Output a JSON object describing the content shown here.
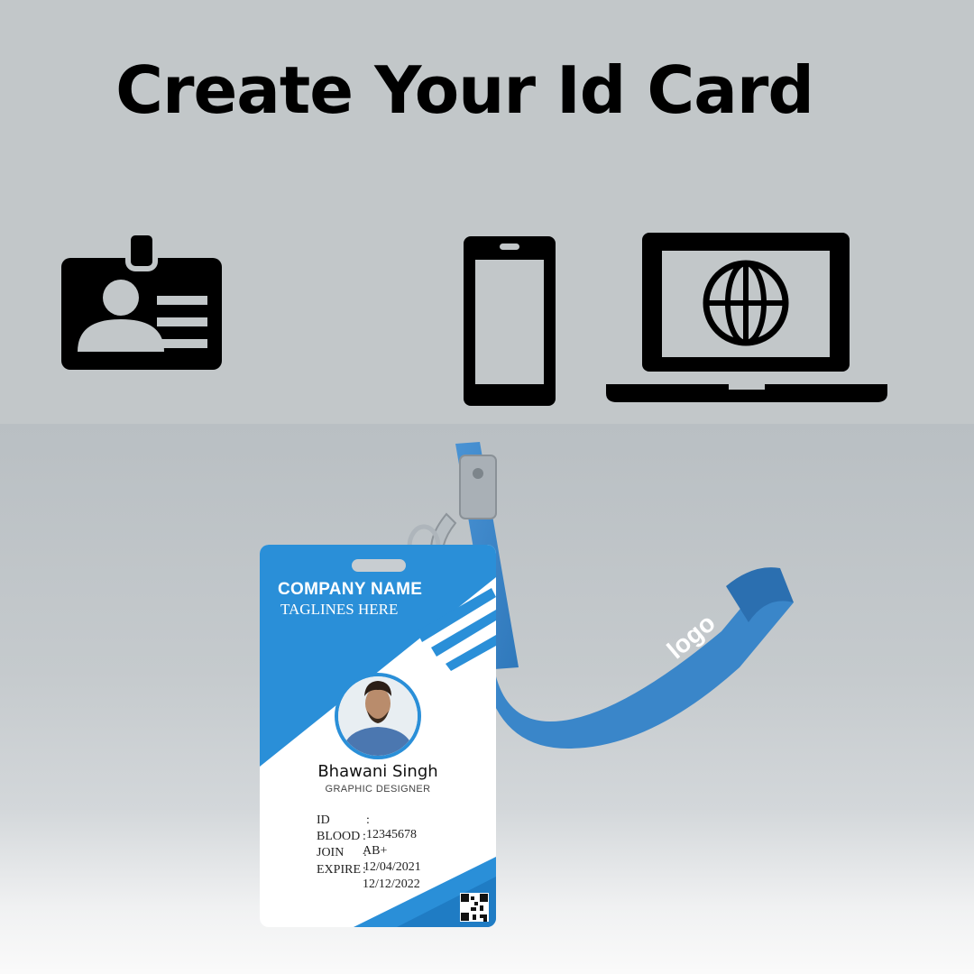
{
  "header": {
    "title": "Create Your Id Card",
    "icons": [
      "id-card-icon",
      "smartphone-icon",
      "laptop-globe-icon"
    ]
  },
  "card": {
    "company_name": "COMPANY NAME",
    "tagline": "TAGLINES HERE",
    "person_name": "Bhawani Singh",
    "job_title": "GRAPHIC DESIGNER",
    "fields": [
      {
        "label": "ID",
        "value": ": 12345678"
      },
      {
        "label": "BLOOD",
        "value": ": AB+"
      },
      {
        "label": "JOIN",
        "value": ": 12/04/2021"
      },
      {
        "label": "EXPIRE",
        "value": ": 12/12/2022"
      }
    ],
    "accent_color": "#2a8fd8"
  },
  "lanyard": {
    "logo_text": "logo",
    "color": "#3e86c8"
  }
}
